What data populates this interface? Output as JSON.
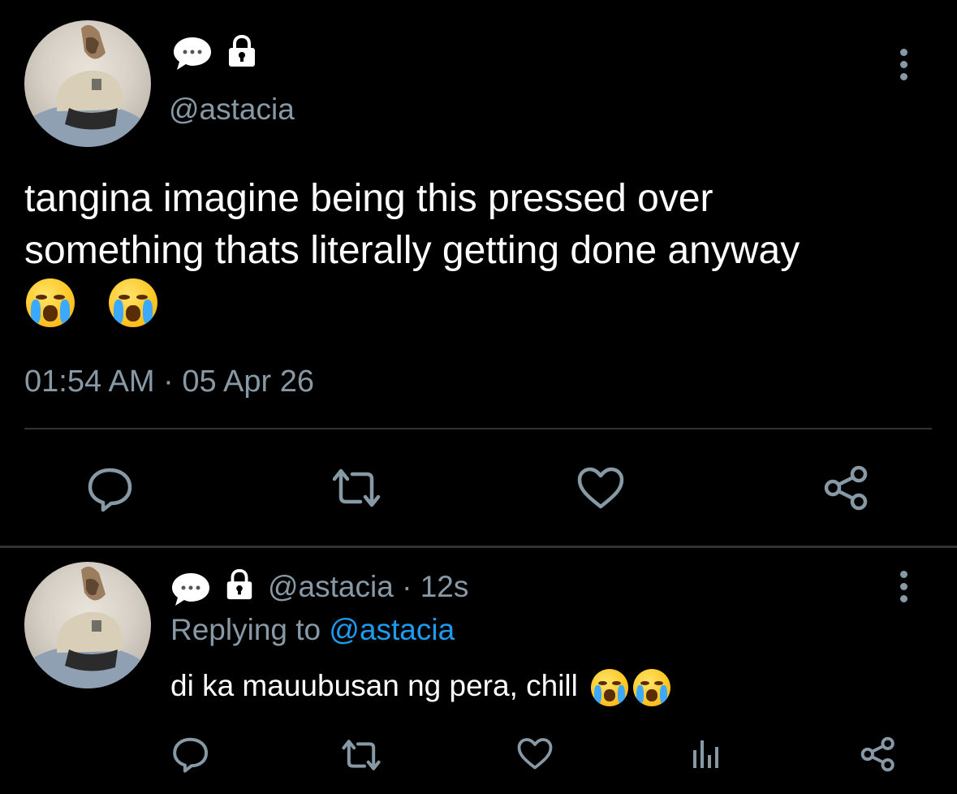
{
  "main_tweet": {
    "handle": "@astacia",
    "text_line1": "tangina imagine being this pressed over",
    "text_line2": "something thats literally getting done anyway",
    "text_emojis": "😭😭",
    "timestamp": "01:54 AM · 05 Apr 26",
    "badges": [
      "speech-bubble-icon",
      "lock-icon"
    ]
  },
  "reply_tweet": {
    "handle": "@astacia",
    "time_sep": " · ",
    "time": "12s",
    "replying_label": "Replying to ",
    "replying_to": "@astacia",
    "text": "di ka mauubusan ng pera, chill",
    "text_emojis": "😭😭",
    "badges": [
      "speech-bubble-icon",
      "lock-icon"
    ]
  },
  "actions": [
    "reply-icon",
    "retweet-icon",
    "like-icon",
    "share-icon"
  ],
  "reply_actions": [
    "reply-icon",
    "retweet-icon",
    "like-icon",
    "analytics-icon",
    "share-icon"
  ],
  "colors": {
    "background": "#000000",
    "text": "#ffffff",
    "muted": "#8899a6",
    "link": "#1d9bf0",
    "divider": "#2f3336"
  }
}
